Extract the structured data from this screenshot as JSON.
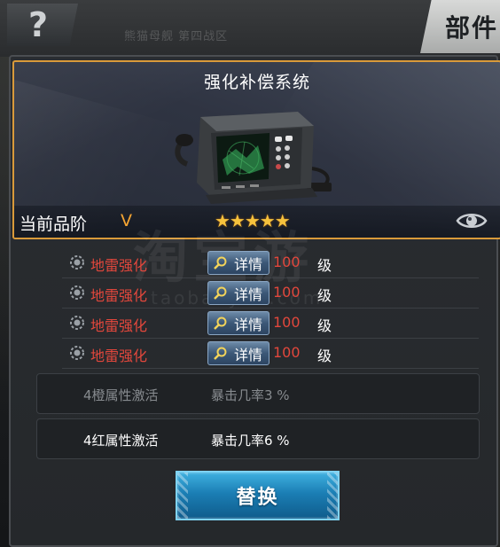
{
  "header": {
    "help_glyph": "?",
    "title": "部件",
    "background_text": "熊猫母舰 第四战区"
  },
  "equipment": {
    "name": "强化补偿系统",
    "grade_label": "当前品阶",
    "grade_value": "V",
    "stars": 5,
    "stars_text": "★★★★★",
    "image": "radar-display-device",
    "view_icon": "eye-icon"
  },
  "enhancements": [
    {
      "name": "地雷强化",
      "button": "详情",
      "level": "100",
      "unit": "级"
    },
    {
      "name": "地雷强化",
      "button": "详情",
      "level": "100",
      "unit": "级"
    },
    {
      "name": "地雷强化",
      "button": "详情",
      "level": "100",
      "unit": "级"
    },
    {
      "name": "地雷强化",
      "button": "详情",
      "level": "100",
      "unit": "级"
    }
  ],
  "attributes": [
    {
      "name": "4橙属性激活",
      "value": "暴击几率3 %",
      "active": false
    },
    {
      "name": "4红属性激活",
      "value": "暴击几率6 %",
      "active": true
    }
  ],
  "actions": {
    "replace_label": "替换"
  },
  "watermark": {
    "cn": "淘宝游",
    "en": "taobaoyou.com"
  },
  "colors": {
    "accent_orange": "#d99a3a",
    "enhance_red": "#e2473c",
    "star_gold": "#f6c23d",
    "button_blue": "#1b7eb4"
  }
}
